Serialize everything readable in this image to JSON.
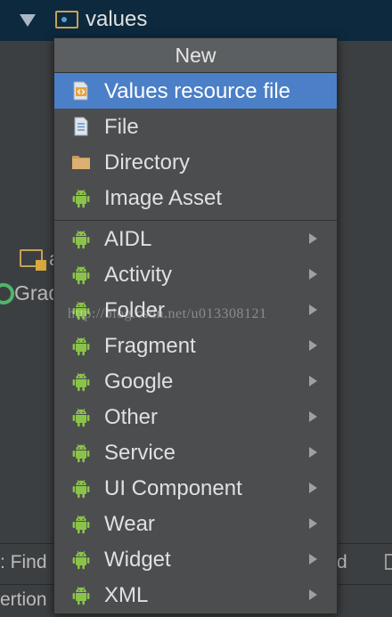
{
  "tree": {
    "folder_label": "values"
  },
  "background": {
    "a_text": "a",
    "gradle_text": "Grad",
    "find_text": ": Find",
    "d_text": "d",
    "ertion_text": "ertion"
  },
  "watermark": "http://blog.csdn.net/u013308121",
  "menu": {
    "header": "New",
    "selected_index": 0,
    "group1": [
      {
        "label": "Values resource file",
        "icon": "values-file-icon"
      },
      {
        "label": "File",
        "icon": "file-icon"
      },
      {
        "label": "Directory",
        "icon": "folder-icon"
      },
      {
        "label": "Image Asset",
        "icon": "android-icon"
      }
    ],
    "group2": [
      {
        "label": "AIDL",
        "icon": "android-icon"
      },
      {
        "label": "Activity",
        "icon": "android-icon"
      },
      {
        "label": "Folder",
        "icon": "android-icon"
      },
      {
        "label": "Fragment",
        "icon": "android-icon"
      },
      {
        "label": "Google",
        "icon": "android-icon"
      },
      {
        "label": "Other",
        "icon": "android-icon"
      },
      {
        "label": "Service",
        "icon": "android-icon"
      },
      {
        "label": "UI Component",
        "icon": "android-icon"
      },
      {
        "label": "Wear",
        "icon": "android-icon"
      },
      {
        "label": "Widget",
        "icon": "android-icon"
      },
      {
        "label": "XML",
        "icon": "android-icon"
      }
    ]
  },
  "colors": {
    "selection": "#4b7fc7",
    "android": "#8bc34a",
    "tree_selection": "#0d293e"
  }
}
